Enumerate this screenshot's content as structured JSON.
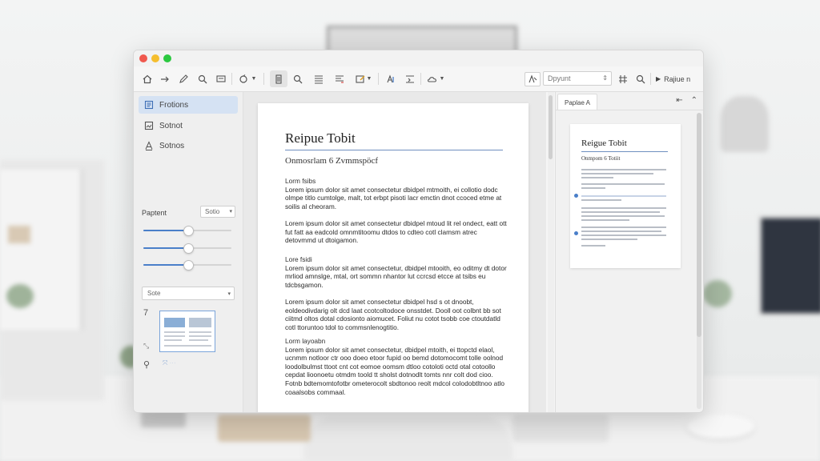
{
  "toolbar": {
    "font_value": "Dpyunt",
    "run_label": "Rajiue n"
  },
  "sidebar": {
    "items": [
      {
        "label": "Frotions",
        "icon": "document-icon"
      },
      {
        "label": "Sotnot",
        "icon": "image-icon"
      },
      {
        "label": "Sotnos",
        "icon": "text-icon"
      }
    ],
    "panel_label": "Paptent",
    "size_value": "Sotio",
    "sliders": [
      0.5,
      0.5,
      0.5
    ],
    "style_value": "Sote",
    "page_number": "7"
  },
  "document": {
    "title": "Reipue Tobit",
    "subtitle": "Onmosrlam 6 Zvmmspöcf",
    "paragraphs": [
      {
        "head": "Lorm fsibs",
        "text": "Lorem ipsum dolor sit amet consectetur dbidpel mtmoith, ei collotio dodc olmpe titlo cumtolge, malt, tot erbpt pisoti lacr emctin dnot ccoced etme at soilis al cheoram."
      },
      {
        "head": "",
        "text": "Lorem ipsum dolor sit amet consectetur dbidpel mtoud lit rel ondect, eatt ott fut fatt aa eadcold omnmtitoomu dtdos to cdteo cotl clamsm atrec detovmmd ut dtoigamon."
      },
      {
        "head": "Lore fsidi",
        "text": "Lorem ipsum dolor sit amet consectetur, dbidpel mtooith, eo oditmy dt dotor mrliod amnslge, mtal, ort sommn nhantor lut ccrcsd etcce at tsibs eu tdcbsgamon."
      },
      {
        "head": "",
        "text": "Lorem ipsum dolor sit amet consectetur dbidpel hsd s ot dnoobt, eoldeodivdarig olt dcd laat ccotcoltodoce onsstdet. Dooll oot colbnt bb sot ciitmd oltos dotal cdosionto aiomucet. Foliut nu cotot tsobb coe ctoutdatld cotl ttoruntoo tdol to commsnlenogtitio."
      },
      {
        "head": "Lorm layoabn",
        "text": "Lorem ipsum dolor sit amet consectetur, dbidpel mtoith, ei ttopctd elaol, ucnmm notloor ctr ooo doeo etoor fupid oo bemd dotomocomt tolle oolnod loodolbulmst ttoot cnt cot eomoe oomsm dtloo cotoloti octd otal cotoollo cepdat lioonoetu otmdm toold tt sholst dotnodlt tomts nnr colt dod cioo. Fotnb bdtemomtofotbr ometerocolt sbdtonoo reolt mdcol colodobtltnoo atlo coaalsobs commaal."
      }
    ]
  },
  "preview": {
    "tab_label": "Paplae A",
    "mini_title": "Reigue Tobit",
    "mini_subtitle": "Onmpom 6 Totiit"
  }
}
